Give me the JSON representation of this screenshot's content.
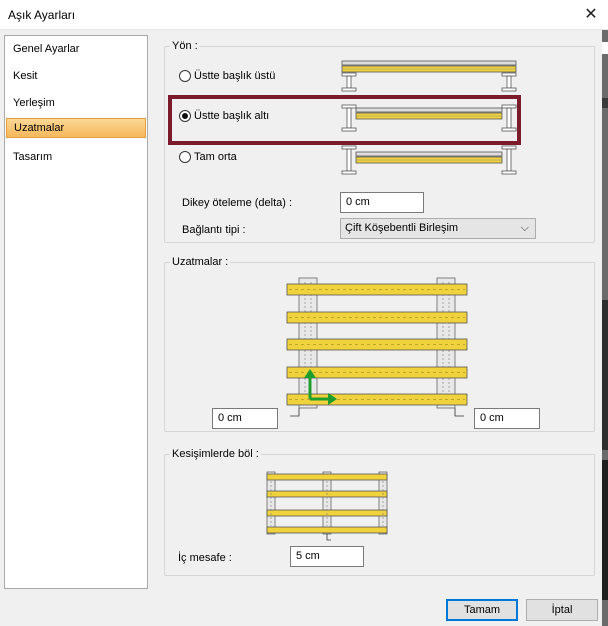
{
  "window": {
    "title": "Aşık Ayarları"
  },
  "sidebar": {
    "items": [
      {
        "label": "Genel Ayarlar",
        "active": false
      },
      {
        "label": "Kesit",
        "active": false
      },
      {
        "label": "Yerleşim",
        "active": false
      },
      {
        "label": "Uzatmalar",
        "active": true
      },
      {
        "label": "Tasarım",
        "active": false
      }
    ]
  },
  "yon": {
    "title": "Yön :",
    "options": [
      {
        "label": "Üstte başlık üstü",
        "selected": false
      },
      {
        "label": "Üstte başlık altı",
        "selected": true
      },
      {
        "label": "Tam orta",
        "selected": false
      }
    ],
    "dikey_label": "Dikey öteleme (delta) :",
    "dikey_value": "0 cm",
    "baglanti_label": "Bağlantı tipi :",
    "baglanti_value": "Çift Köşebentli Birleşim"
  },
  "uzatmalar": {
    "title": "Uzatmalar :",
    "left_value": "0 cm",
    "right_value": "0 cm"
  },
  "kesisim": {
    "title": "Kesişimlerde böl :",
    "ic_label": "İç mesafe :",
    "ic_value": "5 cm"
  },
  "buttons": {
    "ok": "Tamam",
    "cancel": "İptal"
  },
  "colors": {
    "beam_yellow": "#f0d23c",
    "highlight_frame": "#7b1a2a",
    "arrow_green": "#1f9e2e",
    "active_tab": "#f6b65b"
  }
}
